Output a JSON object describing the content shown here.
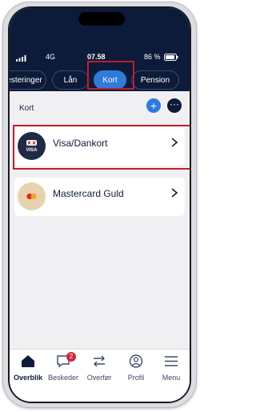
{
  "status_bar": {
    "network": "4G",
    "time": "07.58",
    "battery": "86 %"
  },
  "tabs": [
    {
      "label": "vesteringer",
      "active": false
    },
    {
      "label": "Lån",
      "active": false
    },
    {
      "label": "Kort",
      "active": true
    },
    {
      "label": "Pension",
      "active": false
    }
  ],
  "section": {
    "title": "Kort",
    "add_icon": "plus-icon",
    "more_icon": "ellipsis-icon"
  },
  "cards": [
    {
      "label": "Visa/Dankort",
      "thumb_text": "VISA"
    },
    {
      "label": "Mastercard Guld"
    }
  ],
  "bottom_nav": [
    {
      "label": "Overblik",
      "icon": "home-icon",
      "active": true
    },
    {
      "label": "Beskeder",
      "icon": "message-icon",
      "badge": "2"
    },
    {
      "label": "Overfør",
      "icon": "transfer-icon"
    },
    {
      "label": "Profil",
      "icon": "profile-icon"
    },
    {
      "label": "Menu",
      "icon": "menu-icon"
    }
  ],
  "colors": {
    "header": "#0d1b3a",
    "accent": "#2f7bdc",
    "highlight": "#c41c2b"
  }
}
